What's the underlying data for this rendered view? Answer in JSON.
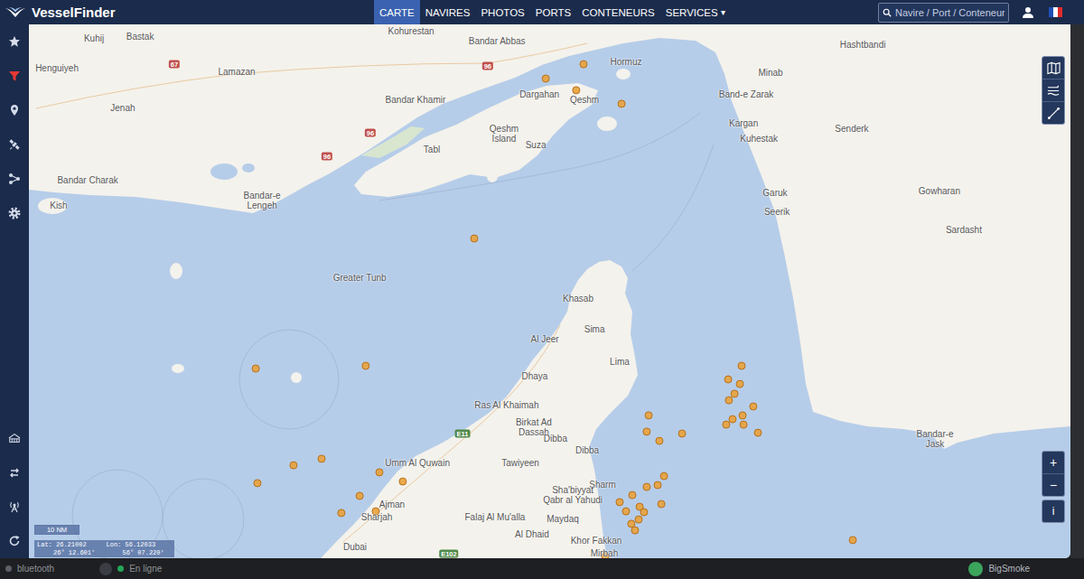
{
  "app": {
    "logo": "VesselFinder"
  },
  "nav": [
    {
      "label": "CARTE",
      "selected": true
    },
    {
      "label": "NAVIRES",
      "selected": false
    },
    {
      "label": "PHOTOS",
      "selected": false
    },
    {
      "label": "PORTS",
      "selected": false
    },
    {
      "label": "CONTENEURS",
      "selected": false
    },
    {
      "label": "SERVICES",
      "selected": false,
      "caret": "▾"
    }
  ],
  "search": {
    "placeholder": "Navire / Port / Conteneur"
  },
  "sidebar": {
    "top": [
      {
        "kind": "favorites",
        "active": false
      },
      {
        "kind": "filter",
        "active": true
      },
      {
        "kind": "places",
        "active": false
      },
      {
        "kind": "satellite",
        "active": false
      },
      {
        "kind": "routes",
        "active": false
      },
      {
        "kind": "settings",
        "active": false
      }
    ],
    "bottom": [
      {
        "kind": "ports",
        "active": false
      },
      {
        "kind": "switch",
        "active": false
      },
      {
        "kind": "antenna",
        "active": false
      },
      {
        "kind": "refresh",
        "active": false
      }
    ]
  },
  "map": {
    "labels": [
      {
        "lines": [
          "Kohurestan"
        ],
        "lat": 27.177,
        "lon": 55.567
      },
      {
        "lines": [
          "Bastak"
        ],
        "lat": 27.157,
        "lon": 54.456
      },
      {
        "lines": [
          "Kuhij"
        ],
        "lat": 27.15,
        "lon": 54.267
      },
      {
        "lines": [
          "Henguiyeh"
        ],
        "lat": 27.04,
        "lon": 54.115
      },
      {
        "lines": [
          "Lamazan"
        ],
        "lat": 27.027,
        "lon": 54.852
      },
      {
        "lines": [
          "Jenah"
        ],
        "lat": 26.893,
        "lon": 54.385
      },
      {
        "lines": [
          "Bandar Abbas"
        ],
        "lat": 27.14,
        "lon": 55.919
      },
      {
        "lines": [
          "Hormuz"
        ],
        "lat": 27.063,
        "lon": 56.448
      },
      {
        "lines": [
          "Minab"
        ],
        "lat": 27.023,
        "lon": 57.041
      },
      {
        "lines": [
          "Hashtbandi"
        ],
        "lat": 27.127,
        "lon": 57.419
      },
      {
        "lines": [
          "Band-e Zarak"
        ],
        "lat": 26.943,
        "lon": 56.941
      },
      {
        "lines": [
          "Kargan"
        ],
        "lat": 26.837,
        "lon": 56.93
      },
      {
        "lines": [
          "Dargahan"
        ],
        "lat": 26.943,
        "lon": 56.093
      },
      {
        "lines": [
          "Qeshm"
        ],
        "lat": 26.923,
        "lon": 56.278
      },
      {
        "lines": [
          "Bandar Khamir"
        ],
        "lat": 26.923,
        "lon": 55.585
      },
      {
        "lines": [
          "Qeshm",
          "Island"
        ],
        "lat": 26.797,
        "lon": 55.948
      },
      {
        "lines": [
          "Suza"
        ],
        "lat": 26.757,
        "lon": 56.078
      },
      {
        "lines": [
          "Tabl"
        ],
        "lat": 26.74,
        "lon": 55.652
      },
      {
        "lines": [
          "Bandar Charak"
        ],
        "lat": 26.627,
        "lon": 54.241
      },
      {
        "lines": [
          "Kish"
        ],
        "lat": 26.533,
        "lon": 54.122
      },
      {
        "lines": [
          "Bandar-e",
          "Lengeh"
        ],
        "lat": 26.55,
        "lon": 54.956
      },
      {
        "lines": [
          "Greater Tunb"
        ],
        "lat": 26.267,
        "lon": 55.356
      },
      {
        "lines": [
          "Khasab"
        ],
        "lat": 26.19,
        "lon": 56.252
      },
      {
        "lines": [
          "Sima"
        ],
        "lat": 26.077,
        "lon": 56.319
      },
      {
        "lines": [
          "Al Jeer"
        ],
        "lat": 26.04,
        "lon": 56.115
      },
      {
        "lines": [
          "Lima"
        ],
        "lat": 25.957,
        "lon": 56.422
      },
      {
        "lines": [
          "Dhaya"
        ],
        "lat": 25.903,
        "lon": 56.074
      },
      {
        "lines": [
          "Ras Al Khaimah"
        ],
        "lat": 25.797,
        "lon": 55.959
      },
      {
        "lines": [
          "Birkat Ad",
          "Dassah"
        ],
        "lat": 25.713,
        "lon": 56.07
      },
      {
        "lines": [
          "Umm Al Quwain"
        ],
        "lat": 25.583,
        "lon": 55.593
      },
      {
        "lines": [
          "Tawiyeen"
        ],
        "lat": 25.583,
        "lon": 56.015
      },
      {
        "lines": [
          "Dibba"
        ],
        "lat": 25.673,
        "lon": 56.159
      },
      {
        "lines": [
          "Dibba"
        ],
        "lat": 25.63,
        "lon": 56.289
      },
      {
        "lines": [
          "Sharm"
        ],
        "lat": 25.503,
        "lon": 56.352
      },
      {
        "lines": [
          "Sha'biyyat",
          "Qabr al Yahudi"
        ],
        "lat": 25.463,
        "lon": 56.23
      },
      {
        "lines": [
          "Ajman"
        ],
        "lat": 25.43,
        "lon": 55.489
      },
      {
        "lines": [
          "Sharjah"
        ],
        "lat": 25.383,
        "lon": 55.426
      },
      {
        "lines": [
          "Falaj Al Mu'alla"
        ],
        "lat": 25.383,
        "lon": 55.911
      },
      {
        "lines": [
          "Maydaq"
        ],
        "lat": 25.377,
        "lon": 56.189
      },
      {
        "lines": [
          "Khor Fakkan"
        ],
        "lat": 25.297,
        "lon": 56.326
      },
      {
        "lines": [
          "Mirbah"
        ],
        "lat": 25.25,
        "lon": 56.359
      },
      {
        "lines": [
          "Al Dhaid"
        ],
        "lat": 25.32,
        "lon": 56.063
      },
      {
        "lines": [
          "Dubai"
        ],
        "lat": 25.273,
        "lon": 55.337
      },
      {
        "lines": [
          "Kuhestak"
        ],
        "lat": 26.78,
        "lon": 56.993
      },
      {
        "lines": [
          "Senderk"
        ],
        "lat": 26.817,
        "lon": 57.374
      },
      {
        "lines": [
          "Garuk"
        ],
        "lat": 26.58,
        "lon": 57.059
      },
      {
        "lines": [
          "Seerik"
        ],
        "lat": 26.51,
        "lon": 57.067
      },
      {
        "lines": [
          "Gowharan"
        ],
        "lat": 26.587,
        "lon": 57.733
      },
      {
        "lines": [
          "Sardasht"
        ],
        "lat": 26.443,
        "lon": 57.833
      },
      {
        "lines": [
          "Bandar-e",
          "Jask"
        ],
        "lat": 25.67,
        "lon": 57.715
      }
    ],
    "roads": [
      {
        "text": "67",
        "lat": 27.053,
        "lon": 54.596,
        "color": "#c0504d"
      },
      {
        "text": "96",
        "lat": 27.047,
        "lon": 55.881,
        "color": "#c0504d"
      },
      {
        "text": "96",
        "lat": 26.8,
        "lon": 55.4,
        "color": "#c0504d"
      },
      {
        "text": "96",
        "lat": 26.713,
        "lon": 55.222,
        "color": "#c0504d"
      },
      {
        "text": "E11",
        "lat": 25.69,
        "lon": 55.778,
        "color": "#4f8a4b"
      },
      {
        "text": "E102",
        "lat": 25.247,
        "lon": 55.722,
        "color": "#4f8a4b"
      }
    ],
    "vessels": [
      {
        "lat": 27.053,
        "lon": 56.274
      },
      {
        "lat": 27.0,
        "lon": 56.119
      },
      {
        "lat": 26.957,
        "lon": 56.244
      },
      {
        "lat": 26.907,
        "lon": 56.43
      },
      {
        "lat": 26.41,
        "lon": 55.826
      },
      {
        "lat": 25.93,
        "lon": 54.93
      },
      {
        "lat": 25.94,
        "lon": 55.381
      },
      {
        "lat": 25.507,
        "lon": 54.937
      },
      {
        "lat": 25.573,
        "lon": 55.085
      },
      {
        "lat": 25.597,
        "lon": 55.2
      },
      {
        "lat": 25.397,
        "lon": 55.281
      },
      {
        "lat": 25.46,
        "lon": 55.356
      },
      {
        "lat": 25.547,
        "lon": 55.437
      },
      {
        "lat": 25.513,
        "lon": 55.533
      },
      {
        "lat": 25.403,
        "lon": 55.422
      },
      {
        "lat": 25.94,
        "lon": 56.922
      },
      {
        "lat": 25.89,
        "lon": 56.867
      },
      {
        "lat": 25.873,
        "lon": 56.915
      },
      {
        "lat": 25.837,
        "lon": 56.893
      },
      {
        "lat": 25.813,
        "lon": 56.87
      },
      {
        "lat": 25.79,
        "lon": 56.97
      },
      {
        "lat": 25.757,
        "lon": 56.926
      },
      {
        "lat": 25.743,
        "lon": 56.885
      },
      {
        "lat": 25.723,
        "lon": 56.859
      },
      {
        "lat": 25.723,
        "lon": 56.93
      },
      {
        "lat": 25.693,
        "lon": 56.989
      },
      {
        "lat": 25.757,
        "lon": 56.541
      },
      {
        "lat": 25.69,
        "lon": 56.678
      },
      {
        "lat": 25.663,
        "lon": 56.585
      },
      {
        "lat": 25.697,
        "lon": 56.533
      },
      {
        "lat": 25.533,
        "lon": 56.604
      },
      {
        "lat": 25.5,
        "lon": 56.578
      },
      {
        "lat": 25.493,
        "lon": 56.533
      },
      {
        "lat": 25.463,
        "lon": 56.474
      },
      {
        "lat": 25.437,
        "lon": 56.422
      },
      {
        "lat": 25.43,
        "lon": 56.593
      },
      {
        "lat": 25.42,
        "lon": 56.504
      },
      {
        "lat": 25.4,
        "lon": 56.522
      },
      {
        "lat": 25.403,
        "lon": 56.448
      },
      {
        "lat": 25.373,
        "lon": 56.5
      },
      {
        "lat": 25.357,
        "lon": 56.47
      },
      {
        "lat": 25.333,
        "lon": 56.485
      },
      {
        "lat": 25.297,
        "lon": 57.378
      },
      {
        "lat": 25.237,
        "lon": 56.363
      }
    ],
    "scale": "10 NM",
    "cursor": {
      "lat_label": "Lat:",
      "lat": "26.21002",
      "lat_dms": "26° 12.601'",
      "lon_label": "Lon:",
      "lon": "56.12033",
      "lon_dms": "56° 07.220'"
    }
  },
  "map_controls": {
    "layers": [
      {
        "kind": "map"
      },
      {
        "kind": "weather"
      },
      {
        "kind": "measure"
      }
    ],
    "zoom_in": "+",
    "zoom_out": "−",
    "info": "i"
  },
  "taskbar": {
    "device": "bluetooth",
    "status": "En ligne",
    "user": "BigSmoke"
  }
}
